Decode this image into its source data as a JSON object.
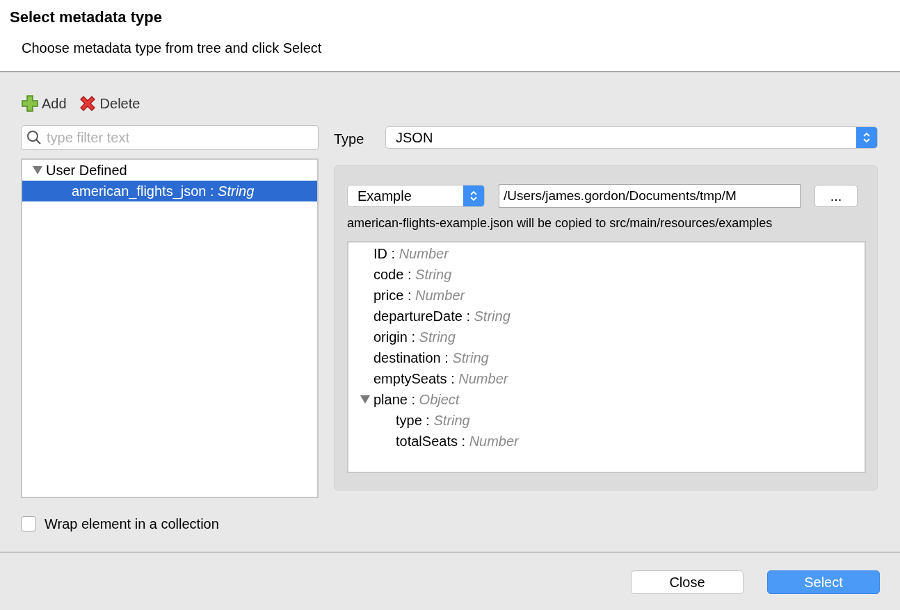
{
  "header": {
    "title": "Select metadata type",
    "subtitle": "Choose metadata type from tree and click Select"
  },
  "toolbar": [
    {
      "kind": "add",
      "label": "Add"
    },
    {
      "kind": "delete",
      "label": "Delete"
    }
  ],
  "filter": {
    "placeholder": "type filter text"
  },
  "tree": [
    {
      "name": "User Defined",
      "expanded": true,
      "selected": false,
      "children": [
        {
          "label": "american_flights_json : *String*",
          "selected": true
        }
      ]
    }
  ],
  "type_field": {
    "label": "Type",
    "value": "JSON"
  },
  "source": {
    "mode": "Example",
    "path": "/Users/james.gordon/Documents/tmp/M",
    "browse": "...",
    "message": "american-flights-example.json will be copied to src/main/resources/examples"
  },
  "fields": [
    {
      "label": "ID : *Number*"
    },
    {
      "label": "code : *String*"
    },
    {
      "label": "price : *Number*"
    },
    {
      "label": "departureDate : *String*"
    },
    {
      "label": "origin : *String*"
    },
    {
      "label": "destination : *String*"
    },
    {
      "label": "emptySeats : *Number*"
    },
    {
      "label": "plane : *Object*",
      "expanded": true,
      "children": [
        {
          "label": "type : *String*"
        },
        {
          "label": "totalSeats : *Number*"
        }
      ]
    }
  ],
  "wrap": {
    "label": "Wrap element in a collection",
    "checked": false
  },
  "buttons": [
    {
      "label": "Close",
      "kind": "default"
    },
    {
      "label": "Select",
      "kind": "primary"
    }
  ]
}
